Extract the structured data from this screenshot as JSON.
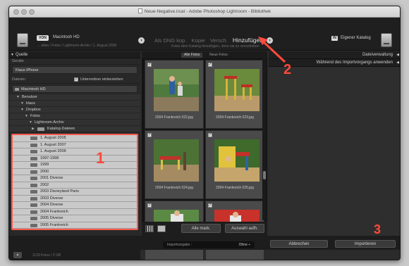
{
  "window": {
    "title": "Neue-Negative.ircat - Adobe Photoshop Lightroom - Bibliothek"
  },
  "topbar": {
    "source_badge": "VON",
    "source_name": "Macintosh HD",
    "source_path": "... altes / Fotos / Lightroom-Archiv / 1. August 2005",
    "modes": [
      "Als DNG kop.",
      "Kopie",
      "Versch.",
      "Hinzufügen"
    ],
    "active_mode": "Hinzufügen",
    "mode_subtitle": "Fotos dem Katalog hinzufügen, ohne sie zu verschieben",
    "dest_badge": "IN",
    "dest_name": "Eigener Katalog"
  },
  "left_panel": {
    "header": "Quelle",
    "section_geraete": "Geräte",
    "device": "Klaus iPhone",
    "section_dateien": "Dateien",
    "subfolders_label": "Unterordner einbeziehen",
    "disk": "Macintosh HD",
    "tree": [
      "Benutzer",
      "klaus",
      "Dropbox",
      "Fotos",
      "Lightroom-Archiv",
      "Katalog-Dateien"
    ],
    "folders": [
      "1. August 2005",
      "1. August 2007",
      "1. August 2009",
      "1997-1998",
      "1999",
      "2000",
      "2001 Diverse",
      "2002",
      "2003 Disneyland Paris",
      "2003 Diverse",
      "2004 Diverse",
      "2004 Frankreich",
      "2005 Diverse",
      "2005 Frankreich"
    ],
    "footer_info": "1129 Fotos / 2 GB"
  },
  "center": {
    "tab_all": "Alle Fotos",
    "tab_new": "Neue Fotos",
    "thumbnails": [
      {
        "caption": "2004 Frankreich 022.jpg",
        "checked": "✓"
      },
      {
        "caption": "2004 Frankreich 023.jpg",
        "checked": "✓"
      },
      {
        "caption": "2004 Frankreich 024.jpg",
        "checked": "✓"
      },
      {
        "caption": "2004 Frankreich 025.jpg",
        "checked": "✓"
      },
      {
        "caption": "",
        "checked": "✓"
      },
      {
        "caption": "",
        "checked": "✓"
      }
    ],
    "check_all": "Alle mark.",
    "uncheck_all": "Auswahl aufh."
  },
  "right_panel": {
    "file_handling": "Dateiverwaltung",
    "apply_during_import": "Während des Importvorgangs anwenden"
  },
  "bottom": {
    "preset_label": "Importvorgabe :",
    "preset_value": "Ohne ÷",
    "cancel": "Abbrechen",
    "import": "Importieren"
  },
  "annotations": {
    "one": "1",
    "two": "2",
    "three": "3"
  },
  "colors": {
    "annotation": "#ff4a3d",
    "panel": "#2b2b2b",
    "folder_row": "#c9c9c9"
  }
}
